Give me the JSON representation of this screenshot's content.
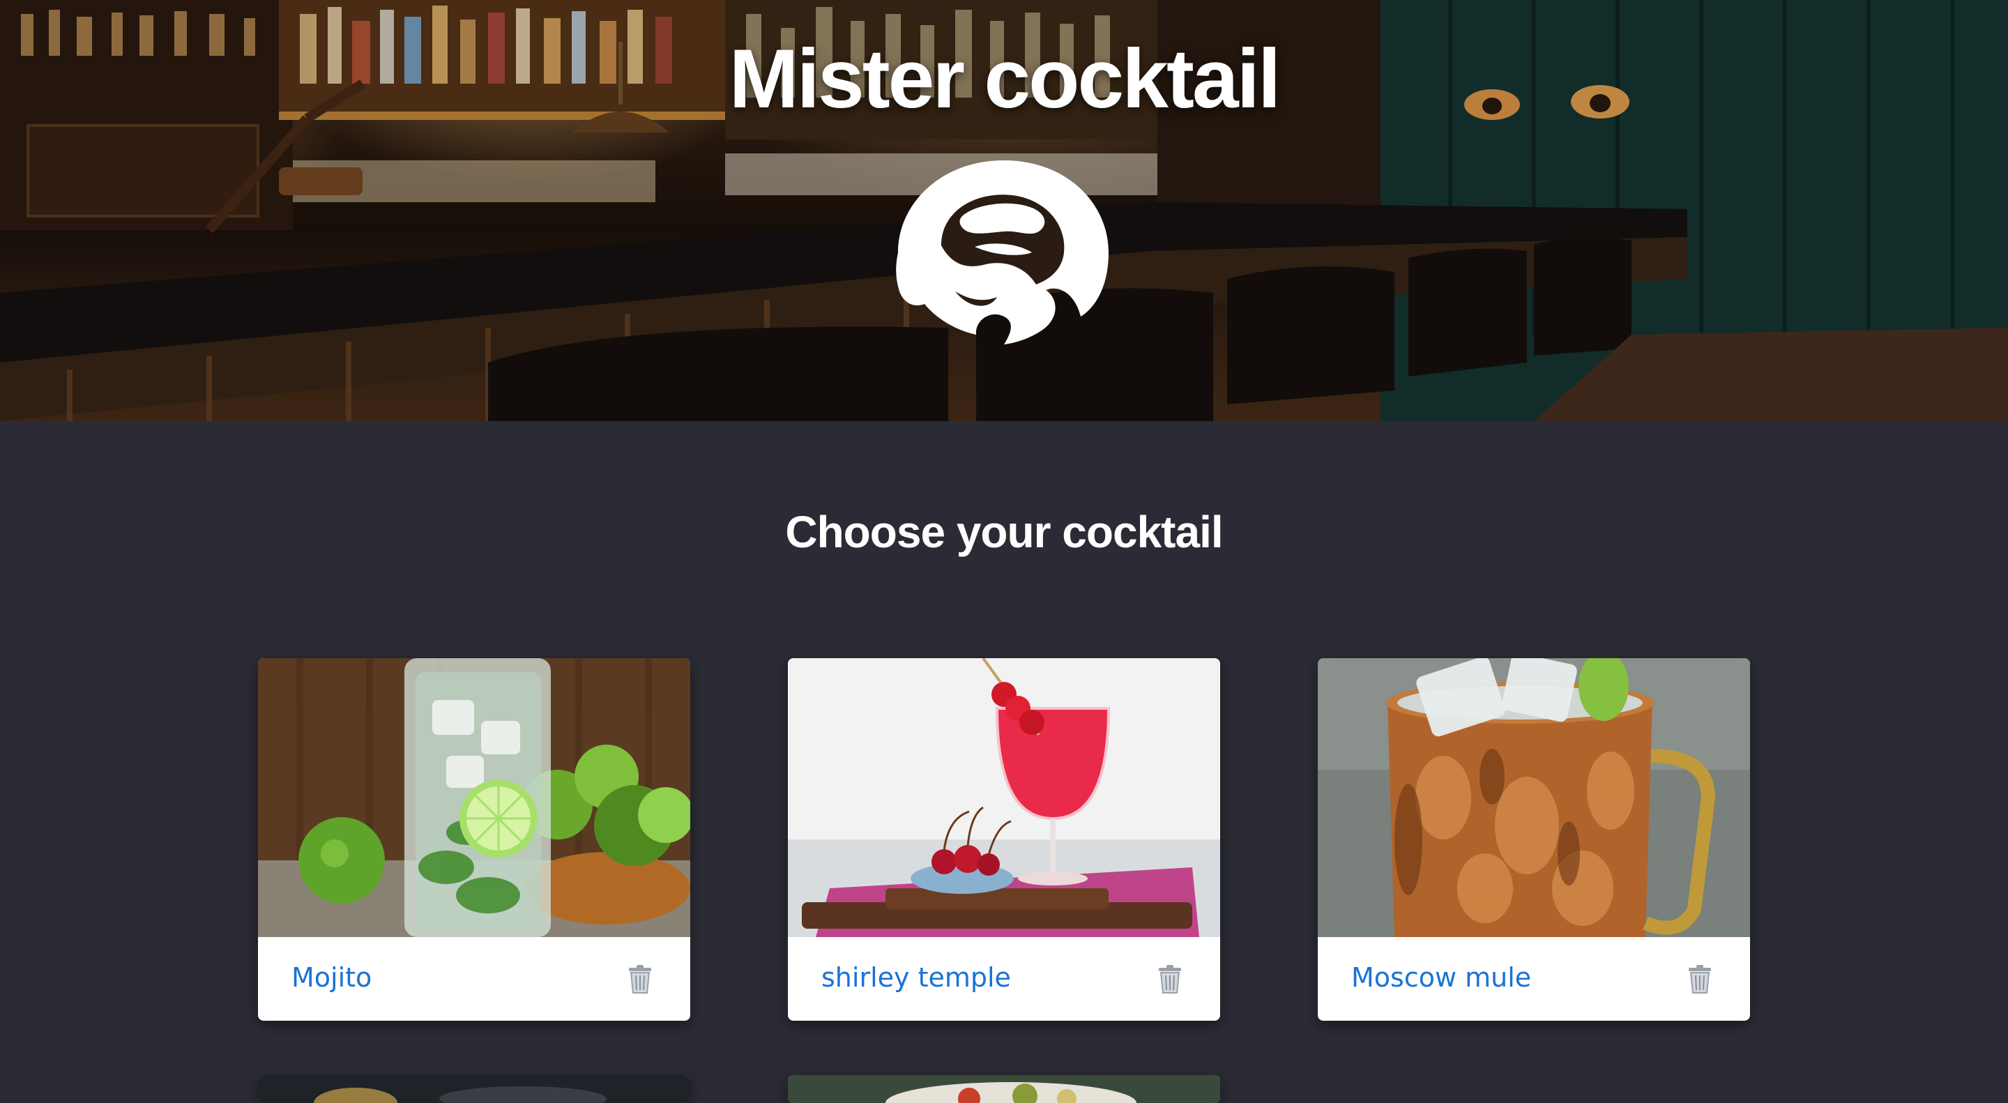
{
  "header": {
    "title": "Mister cocktail",
    "logo_icon": "cocktail-hat-logo-icon"
  },
  "main": {
    "heading": "Choose your cocktail",
    "cocktails": [
      {
        "name": "Mojito",
        "delete_icon": "trash-icon"
      },
      {
        "name": "shirley temple",
        "delete_icon": "trash-icon"
      },
      {
        "name": "Moscow mule",
        "delete_icon": "trash-icon"
      }
    ]
  },
  "colors": {
    "background": "#2b2b35",
    "card": "#ffffff",
    "link": "#1a73d6"
  }
}
